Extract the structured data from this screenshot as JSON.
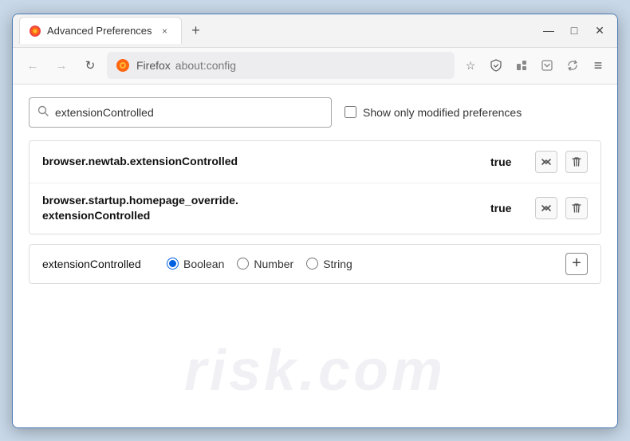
{
  "window": {
    "title": "Advanced Preferences",
    "tab_close": "×",
    "new_tab": "+"
  },
  "controls": {
    "minimize": "—",
    "maximize": "□",
    "close": "✕"
  },
  "nav": {
    "back": "←",
    "forward": "→",
    "reload": "↻",
    "browser_name": "Firefox",
    "url_path": "about:config",
    "bookmark": "☆",
    "shield": "🛡",
    "extension": "🧩",
    "menu": "≡"
  },
  "search": {
    "placeholder": "extensionControlled",
    "value": "extensionControlled",
    "show_modified_label": "Show only modified preferences"
  },
  "results": [
    {
      "name": "browser.newtab.extensionControlled",
      "value": "true"
    },
    {
      "name": "browser.startup.homepage_override.\nextensionControlled",
      "name_line1": "browser.startup.homepage_override.",
      "name_line2": "extensionControlled",
      "value": "true",
      "multiline": true
    }
  ],
  "new_pref": {
    "name": "extensionControlled",
    "types": [
      "Boolean",
      "Number",
      "String"
    ],
    "selected_type": "Boolean"
  },
  "watermark": "risk.com"
}
